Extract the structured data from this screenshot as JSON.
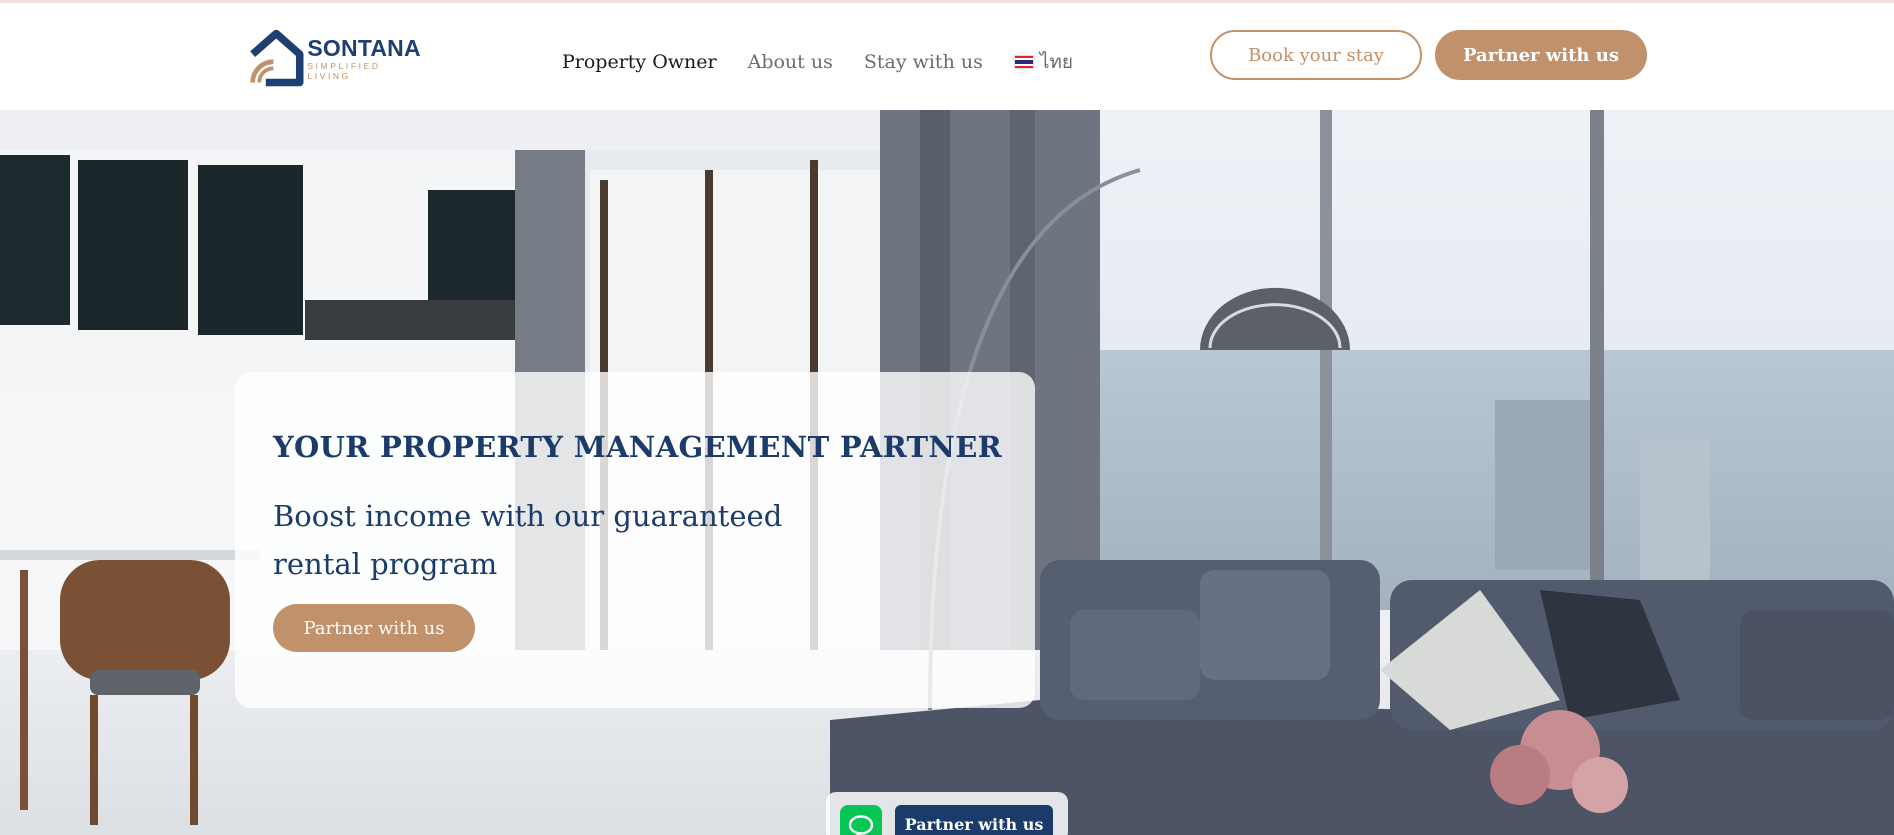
{
  "brand": {
    "name": "SONTANA",
    "tagline": "SIMPLIFIED LIVING",
    "colors": {
      "navy": "#1f3f72",
      "gold": "#c0916a",
      "line_green": "#06c755"
    }
  },
  "nav": {
    "items": [
      {
        "label": "Property Owner",
        "active": true
      },
      {
        "label": "About us",
        "active": false
      },
      {
        "label": "Stay with us",
        "active": false
      }
    ],
    "language": {
      "label": "ไทย",
      "icon": "thai-flag-icon"
    }
  },
  "header_buttons": {
    "book": "Book your stay",
    "partner": "Partner with us"
  },
  "hero": {
    "title": "YOUR PROPERTY MANAGEMENT PARTNER",
    "subtitle_line1": "Boost income with our guaranteed",
    "subtitle_line2": "rental program",
    "cta": "Partner with us"
  },
  "floating_bar": {
    "chat_icon": "line-chat-icon",
    "cta": "Partner with us"
  }
}
